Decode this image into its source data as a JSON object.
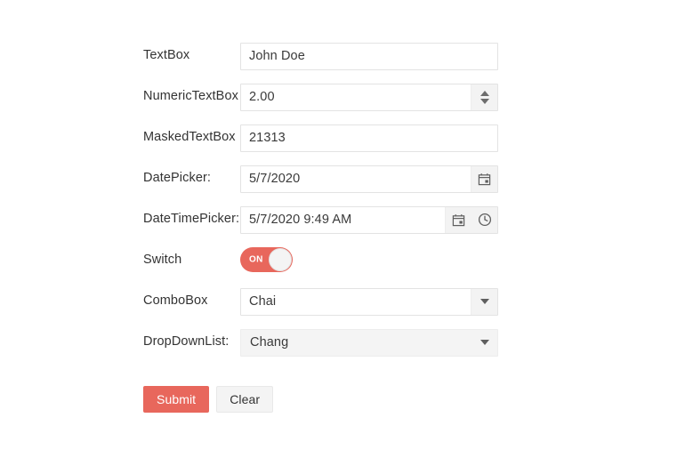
{
  "colors": {
    "accent": "#e8675c",
    "input_border": "#e3e3e3",
    "adorner_bg": "#f3f3f3",
    "filled_bg": "#f4f4f4",
    "label_text": "#333333",
    "value_text": "#3a3a3a",
    "page_bg": "#ffffff"
  },
  "form": {
    "fields": [
      {
        "id": "textbox",
        "label": "TextBox",
        "value": "John Doe",
        "type": "textbox"
      },
      {
        "id": "numerictextbox",
        "label": "NumericTextBox",
        "value": "2.00",
        "type": "numerictextbox",
        "spinner_up_icon": "triangle-up-icon",
        "spinner_down_icon": "triangle-down-icon"
      },
      {
        "id": "maskedtextbox",
        "label": "MaskedTextBox",
        "value": "21313",
        "type": "maskedtextbox"
      },
      {
        "id": "datepicker",
        "label": "DatePicker:",
        "value": "5/7/2020",
        "type": "datepicker",
        "calendar_icon": "calendar-icon"
      },
      {
        "id": "datetimepicker",
        "label": "DateTimePicker:",
        "value": "5/7/2020 9:49 AM",
        "type": "datetimepicker",
        "calendar_icon": "calendar-icon",
        "clock_icon": "clock-icon"
      },
      {
        "id": "switch",
        "label": "Switch",
        "value": "ON",
        "type": "switch",
        "state": "on"
      },
      {
        "id": "combobox",
        "label": "ComboBox",
        "value": "Chai",
        "type": "combobox",
        "arrow_icon": "chevron-down-icon"
      },
      {
        "id": "dropdownlist",
        "label": "DropDownList:",
        "value": "Chang",
        "type": "dropdownlist",
        "arrow_icon": "chevron-down-icon"
      }
    ],
    "actions": {
      "submit_label": "Submit",
      "clear_label": "Clear"
    }
  }
}
